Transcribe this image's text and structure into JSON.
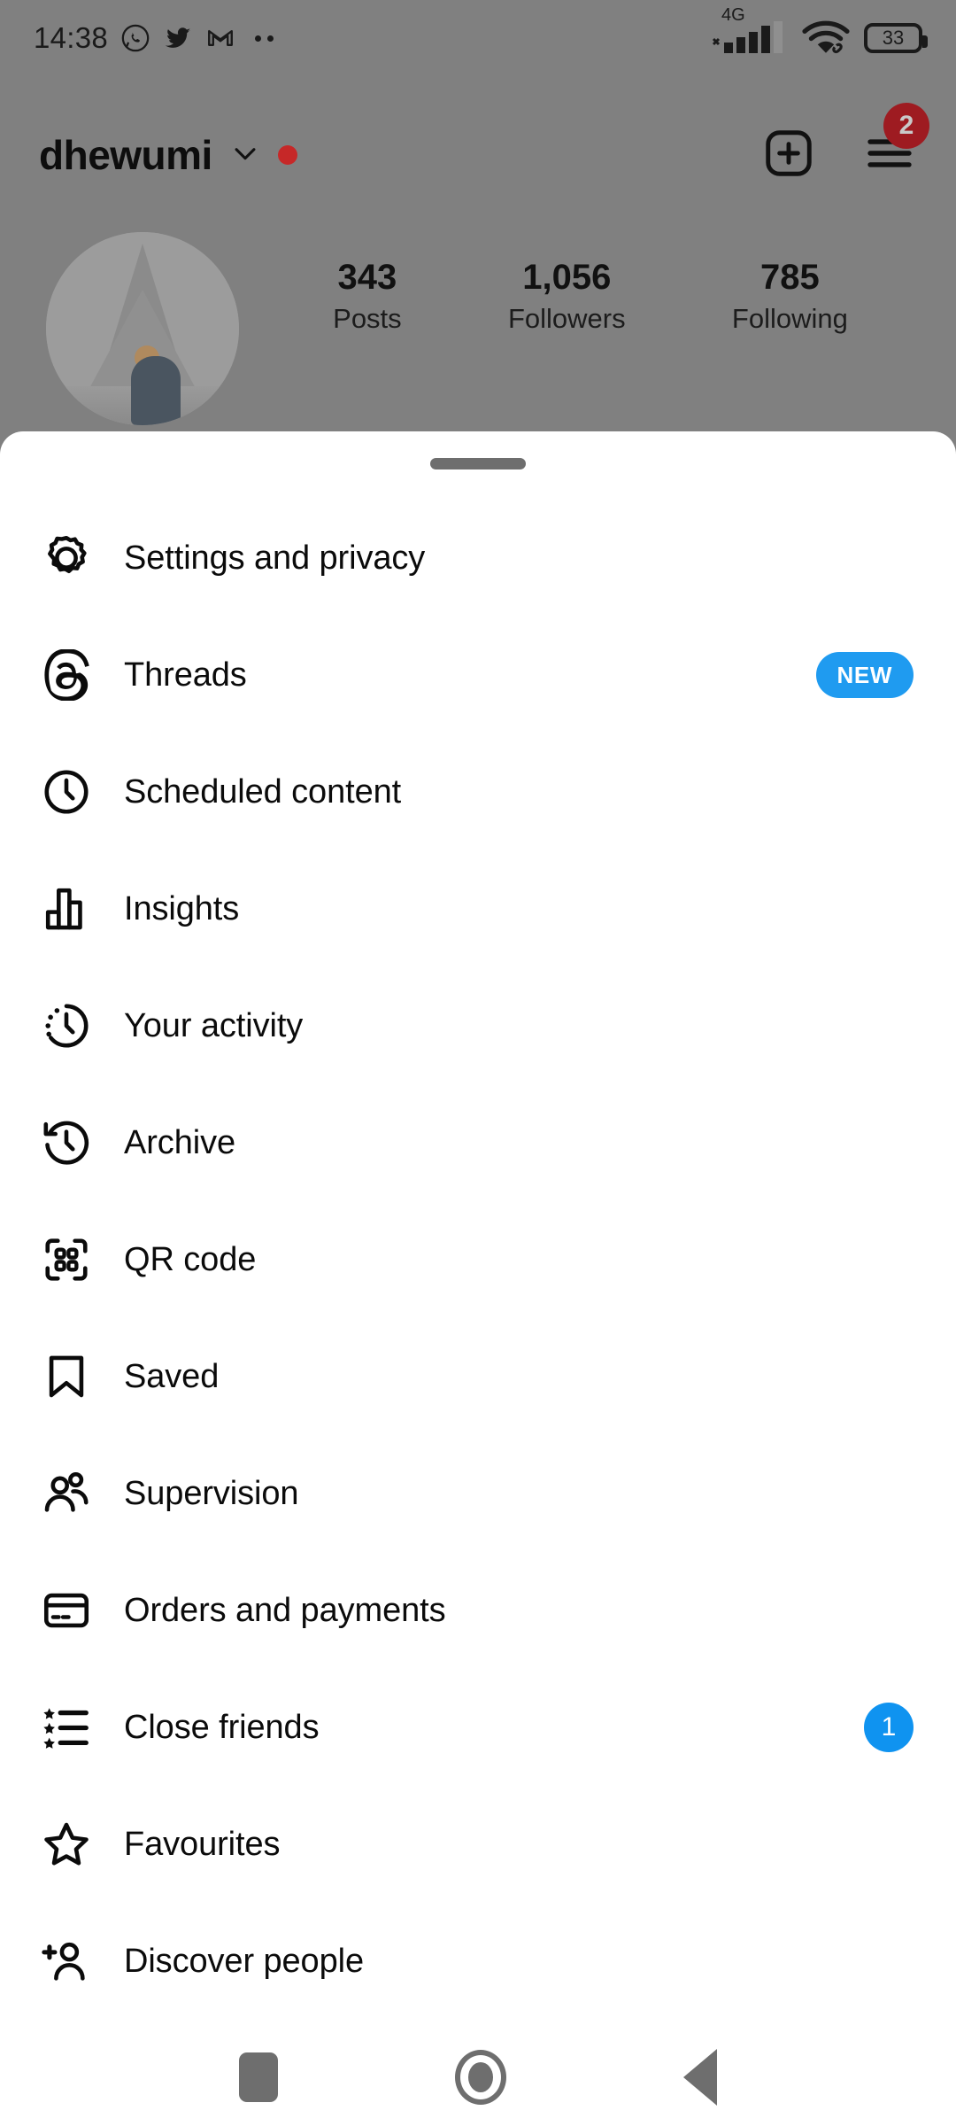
{
  "status_bar": {
    "time": "14:38",
    "left_icons": [
      "whatsapp-icon",
      "twitter-icon",
      "gmail-icon",
      "more-notifications-icon"
    ],
    "network_label": "4G",
    "right_icons": [
      "signal-bars-icon",
      "wifi-icon",
      "battery-icon"
    ],
    "battery_level": "33"
  },
  "profile": {
    "username": "dhewumi",
    "username_chevron": "chevron-down-icon",
    "unread_dot": true,
    "add_button": "plus-box-icon",
    "menu_button": "hamburger-menu-icon",
    "menu_badge": "2",
    "avatar": "profile-photo-eiffel-tower",
    "stats": [
      {
        "value": "343",
        "label": "Posts"
      },
      {
        "value": "1,056",
        "label": "Followers"
      },
      {
        "value": "785",
        "label": "Following"
      }
    ]
  },
  "sheet": {
    "handle": "drag-handle",
    "items": [
      {
        "label": "Settings and privacy",
        "icon": "gear-icon",
        "badge": null,
        "badge_type": null
      },
      {
        "label": "Threads",
        "icon": "threads-icon",
        "badge": "NEW",
        "badge_type": "pill"
      },
      {
        "label": "Scheduled content",
        "icon": "clock-icon",
        "badge": null,
        "badge_type": null
      },
      {
        "label": "Insights",
        "icon": "bar-chart-icon",
        "badge": null,
        "badge_type": null
      },
      {
        "label": "Your activity",
        "icon": "activity-clock-icon",
        "badge": null,
        "badge_type": null
      },
      {
        "label": "Archive",
        "icon": "archive-clock-icon",
        "badge": null,
        "badge_type": null
      },
      {
        "label": "QR code",
        "icon": "qr-code-icon",
        "badge": null,
        "badge_type": null
      },
      {
        "label": "Saved",
        "icon": "bookmark-icon",
        "badge": null,
        "badge_type": null
      },
      {
        "label": "Supervision",
        "icon": "two-people-icon",
        "badge": null,
        "badge_type": null
      },
      {
        "label": "Orders and payments",
        "icon": "credit-card-icon",
        "badge": null,
        "badge_type": null
      },
      {
        "label": "Close friends",
        "icon": "star-list-icon",
        "badge": "1",
        "badge_type": "count"
      },
      {
        "label": "Favourites",
        "icon": "star-icon",
        "badge": null,
        "badge_type": null
      },
      {
        "label": "Discover people",
        "icon": "person-plus-icon",
        "badge": null,
        "badge_type": null
      }
    ]
  },
  "nav_bar": {
    "recents": "recents-square-icon",
    "home": "home-circle-icon",
    "back": "back-triangle-icon"
  },
  "colors": {
    "accent_blue": "#0f93f0",
    "badge_new_blue": "#1f9bf0",
    "notification_red": "#9e1b21",
    "unread_dot_red": "#c62828",
    "scrim": "#808080"
  }
}
